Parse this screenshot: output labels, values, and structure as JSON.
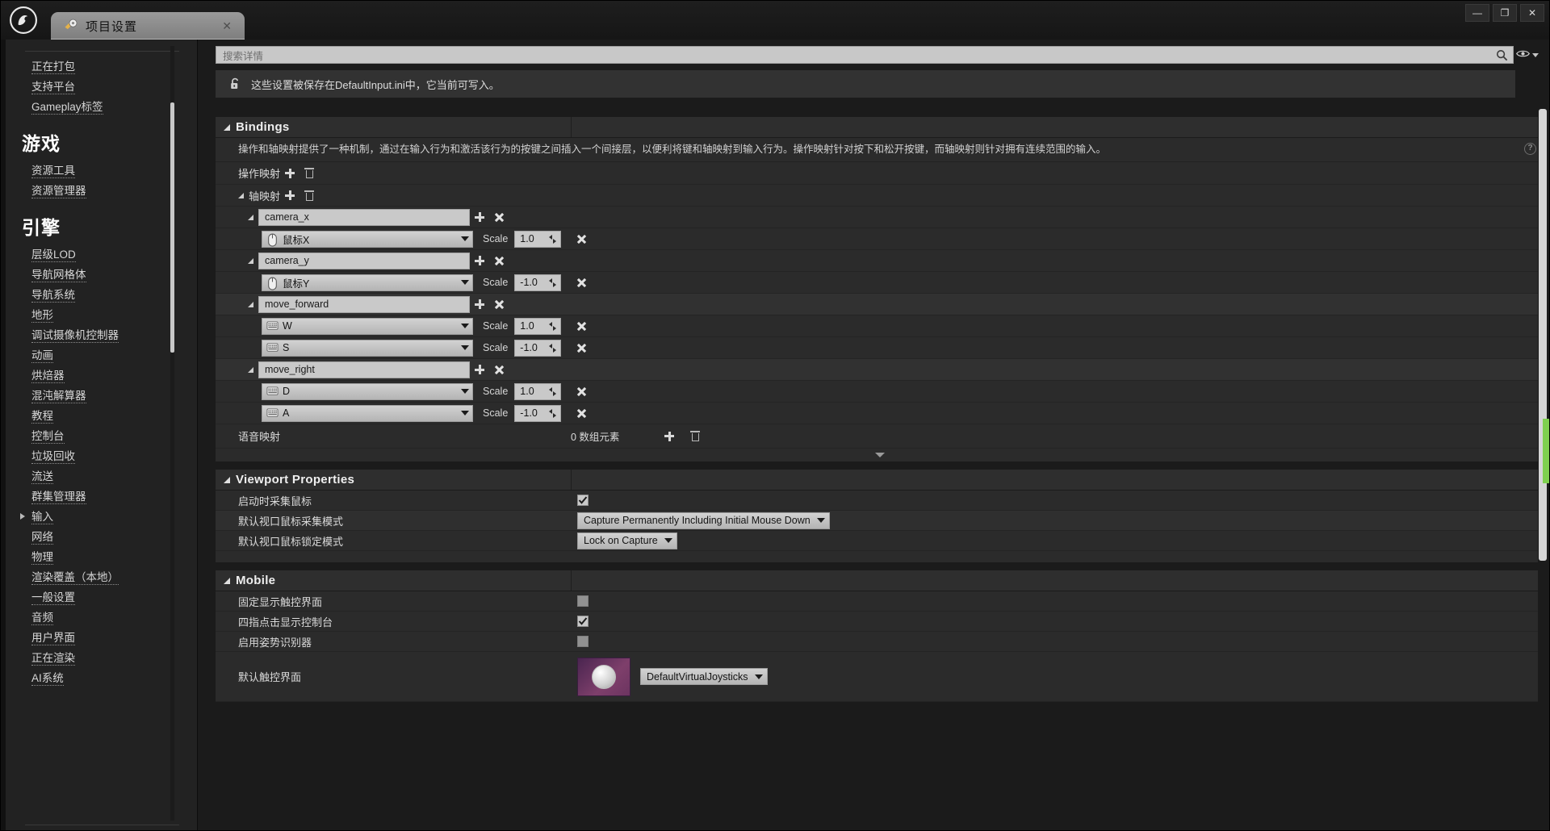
{
  "window": {
    "tab_title": "项目设置",
    "tab_close": "✕",
    "minimize": "—",
    "maximize": "❐",
    "close": "✕",
    "logo_icon": "unreal-engine-logo",
    "tab_icon": "gear-icon"
  },
  "sidebar": {
    "scroll_icon": "sidebar-scrollbar",
    "top_items": [
      {
        "label": "正在打包",
        "icon": ""
      },
      {
        "label": "支持平台",
        "icon": ""
      },
      {
        "label": "Gameplay标签",
        "icon": ""
      }
    ],
    "groups": [
      {
        "title": "游戏",
        "items": [
          {
            "label": "资源工具",
            "expandable": false
          },
          {
            "label": "资源管理器",
            "expandable": false
          }
        ]
      },
      {
        "title": "引擎",
        "items": [
          {
            "label": "层级LOD",
            "expandable": false
          },
          {
            "label": "导航网格体",
            "expandable": false
          },
          {
            "label": "导航系统",
            "expandable": false
          },
          {
            "label": "地形",
            "expandable": false
          },
          {
            "label": "调试摄像机控制器",
            "expandable": false
          },
          {
            "label": "动画",
            "expandable": false
          },
          {
            "label": "烘焙器",
            "expandable": false
          },
          {
            "label": "混沌解算器",
            "expandable": false
          },
          {
            "label": "教程",
            "expandable": false
          },
          {
            "label": "控制台",
            "expandable": false
          },
          {
            "label": "垃圾回收",
            "expandable": false
          },
          {
            "label": "流送",
            "expandable": false
          },
          {
            "label": "群集管理器",
            "expandable": false
          },
          {
            "label": "输入",
            "expandable": true
          },
          {
            "label": "网络",
            "expandable": false
          },
          {
            "label": "物理",
            "expandable": false
          },
          {
            "label": "渲染覆盖（本地）",
            "expandable": false
          },
          {
            "label": "一般设置",
            "expandable": false
          },
          {
            "label": "音频",
            "expandable": false
          },
          {
            "label": "用户界面",
            "expandable": false
          },
          {
            "label": "正在渲染",
            "expandable": false
          },
          {
            "label": "AI系统",
            "expandable": false
          }
        ]
      }
    ]
  },
  "search": {
    "placeholder": "搜索详情",
    "magnifier_icon": "search-icon",
    "eye_icon": "eye-icon",
    "caret_icon": "chevron-down-icon"
  },
  "info_bar": {
    "lock_icon": "unlocked-padlock-icon",
    "text": "这些设置被保存在DefaultInput.ini中，它当前可写入。"
  },
  "bindings": {
    "title": "Bindings",
    "description": "操作和轴映射提供了一种机制，通过在输入行为和激活该行为的按键之间插入一个间接层，以便利将键和轴映射到输入行为。操作映射针对按下和松开按键，而轴映射则针对拥有连续范围的输入。",
    "help_icon": "help-circle-icon",
    "action_mappings": {
      "label": "操作映射",
      "add_icon": "plus-icon",
      "delete_icon": "trash-icon"
    },
    "axis_mappings": {
      "label": "轴映射",
      "add_icon": "plus-icon",
      "delete_icon": "trash-icon",
      "groups": [
        {
          "name": "camera_x",
          "keys": [
            {
              "key": "鼠标X",
              "key_icon": "mouse-icon",
              "scale_label": "Scale",
              "scale": "1.0"
            }
          ]
        },
        {
          "name": "camera_y",
          "keys": [
            {
              "key": "鼠标Y",
              "key_icon": "mouse-icon",
              "scale_label": "Scale",
              "scale": "-1.0"
            }
          ]
        },
        {
          "name": "move_forward",
          "keys": [
            {
              "key": "W",
              "key_icon": "keyboard-icon",
              "scale_label": "Scale",
              "scale": "1.0"
            },
            {
              "key": "S",
              "key_icon": "keyboard-icon",
              "scale_label": "Scale",
              "scale": "-1.0"
            }
          ]
        },
        {
          "name": "move_right",
          "keys": [
            {
              "key": "D",
              "key_icon": "keyboard-icon",
              "scale_label": "Scale",
              "scale": "1.0"
            },
            {
              "key": "A",
              "key_icon": "keyboard-icon",
              "scale_label": "Scale",
              "scale": "-1.0"
            }
          ]
        }
      ]
    },
    "speech_mappings": {
      "label": "语音映射",
      "count": "0 数组元素",
      "add_icon": "plus-icon",
      "delete_icon": "trash-icon"
    }
  },
  "viewport": {
    "title": "Viewport Properties",
    "rows": [
      {
        "label": "启动时采集鼠标",
        "type": "checkbox",
        "checked": true
      },
      {
        "label": "默认视口鼠标采集模式",
        "type": "select",
        "value": "Capture Permanently Including Initial Mouse Down"
      },
      {
        "label": "默认视口鼠标锁定模式",
        "type": "select",
        "value": "Lock on Capture"
      }
    ]
  },
  "mobile": {
    "title": "Mobile",
    "rows": [
      {
        "label": "固定显示触控界面",
        "type": "checkbox",
        "checked": false
      },
      {
        "label": "四指点击显示控制台",
        "type": "checkbox",
        "checked": true
      },
      {
        "label": "启用姿势识别器",
        "type": "checkbox",
        "checked": false
      },
      {
        "label": "默认触控界面",
        "type": "asset",
        "value": "DefaultVirtualJoysticks",
        "thumb_icon": "virtual-joystick-thumbnail"
      }
    ]
  }
}
